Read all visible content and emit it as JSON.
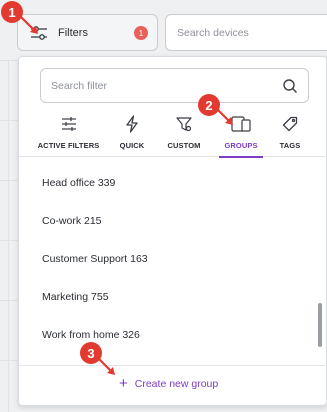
{
  "toolbar": {
    "filters_label": "Filters",
    "filters_badge": "1",
    "search_placeholder": "Search devices"
  },
  "panel": {
    "search_placeholder": "Search filter",
    "tabs": [
      {
        "label": "ACTIVE FILTERS",
        "icon": "sliders-icon"
      },
      {
        "label": "QUICK",
        "icon": "lightning-icon"
      },
      {
        "label": "CUSTOM",
        "icon": "custom-filter-icon"
      },
      {
        "label": "GROUPS",
        "icon": "devices-group-icon",
        "active": true
      },
      {
        "label": "TAGS",
        "icon": "tag-icon"
      }
    ],
    "groups": [
      "Head office 339",
      "Co-work 215",
      "Customer Support 163",
      "Marketing 755",
      "Work from home 326"
    ],
    "create_label": "Create new group"
  },
  "markers": [
    "1",
    "2",
    "3"
  ],
  "colors": {
    "accent": "#7a3fc2",
    "marker": "#e23a30",
    "badge": "#e8605a"
  }
}
